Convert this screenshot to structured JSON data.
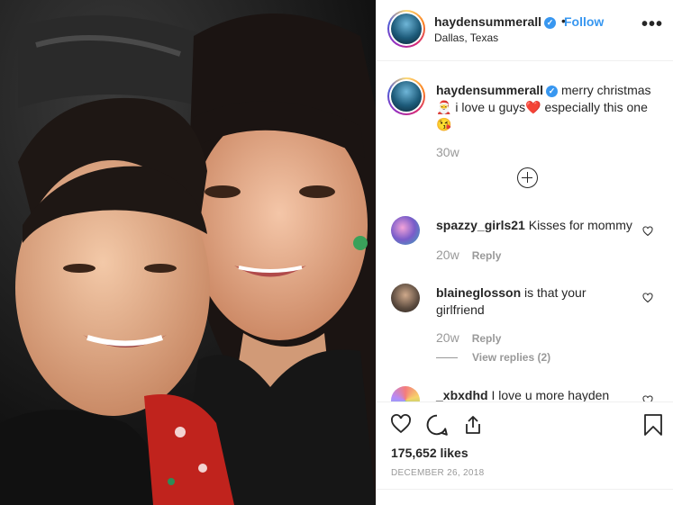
{
  "post": {
    "username": "haydensummerall",
    "follow_label": "Follow",
    "location": "Dallas, Texas",
    "more_label": "•••",
    "caption": {
      "text_part1": "merry christmas",
      "emoji_santa": "🎅",
      "text_part2": "i love u guys",
      "emoji_heart": "❤️",
      "text_part3": "especially this one",
      "emoji_kiss": "😘",
      "time": "30w"
    }
  },
  "comments": [
    {
      "username": "spazzy_girls21",
      "text": "Kisses for mommy",
      "time": "20w",
      "reply_label": "Reply"
    },
    {
      "username": "blaineglosson",
      "text": "is that your girlfriend",
      "time": "20w",
      "reply_label": "Reply",
      "view_replies": "View replies (2)"
    },
    {
      "username": "_xbxdhd",
      "text": "I love u more hayden"
    }
  ],
  "actions": {
    "likes": "175,652 likes",
    "date": "DECEMBER 26, 2018"
  },
  "colors": {
    "link": "#3897f0",
    "muted": "#999999",
    "text": "#262626",
    "heart": "#e0245e"
  },
  "icons": [
    "verified-badge-icon",
    "more-options-icon",
    "load-more-plus-icon",
    "heart-icon",
    "comment-icon",
    "share-icon",
    "bookmark-icon"
  ]
}
